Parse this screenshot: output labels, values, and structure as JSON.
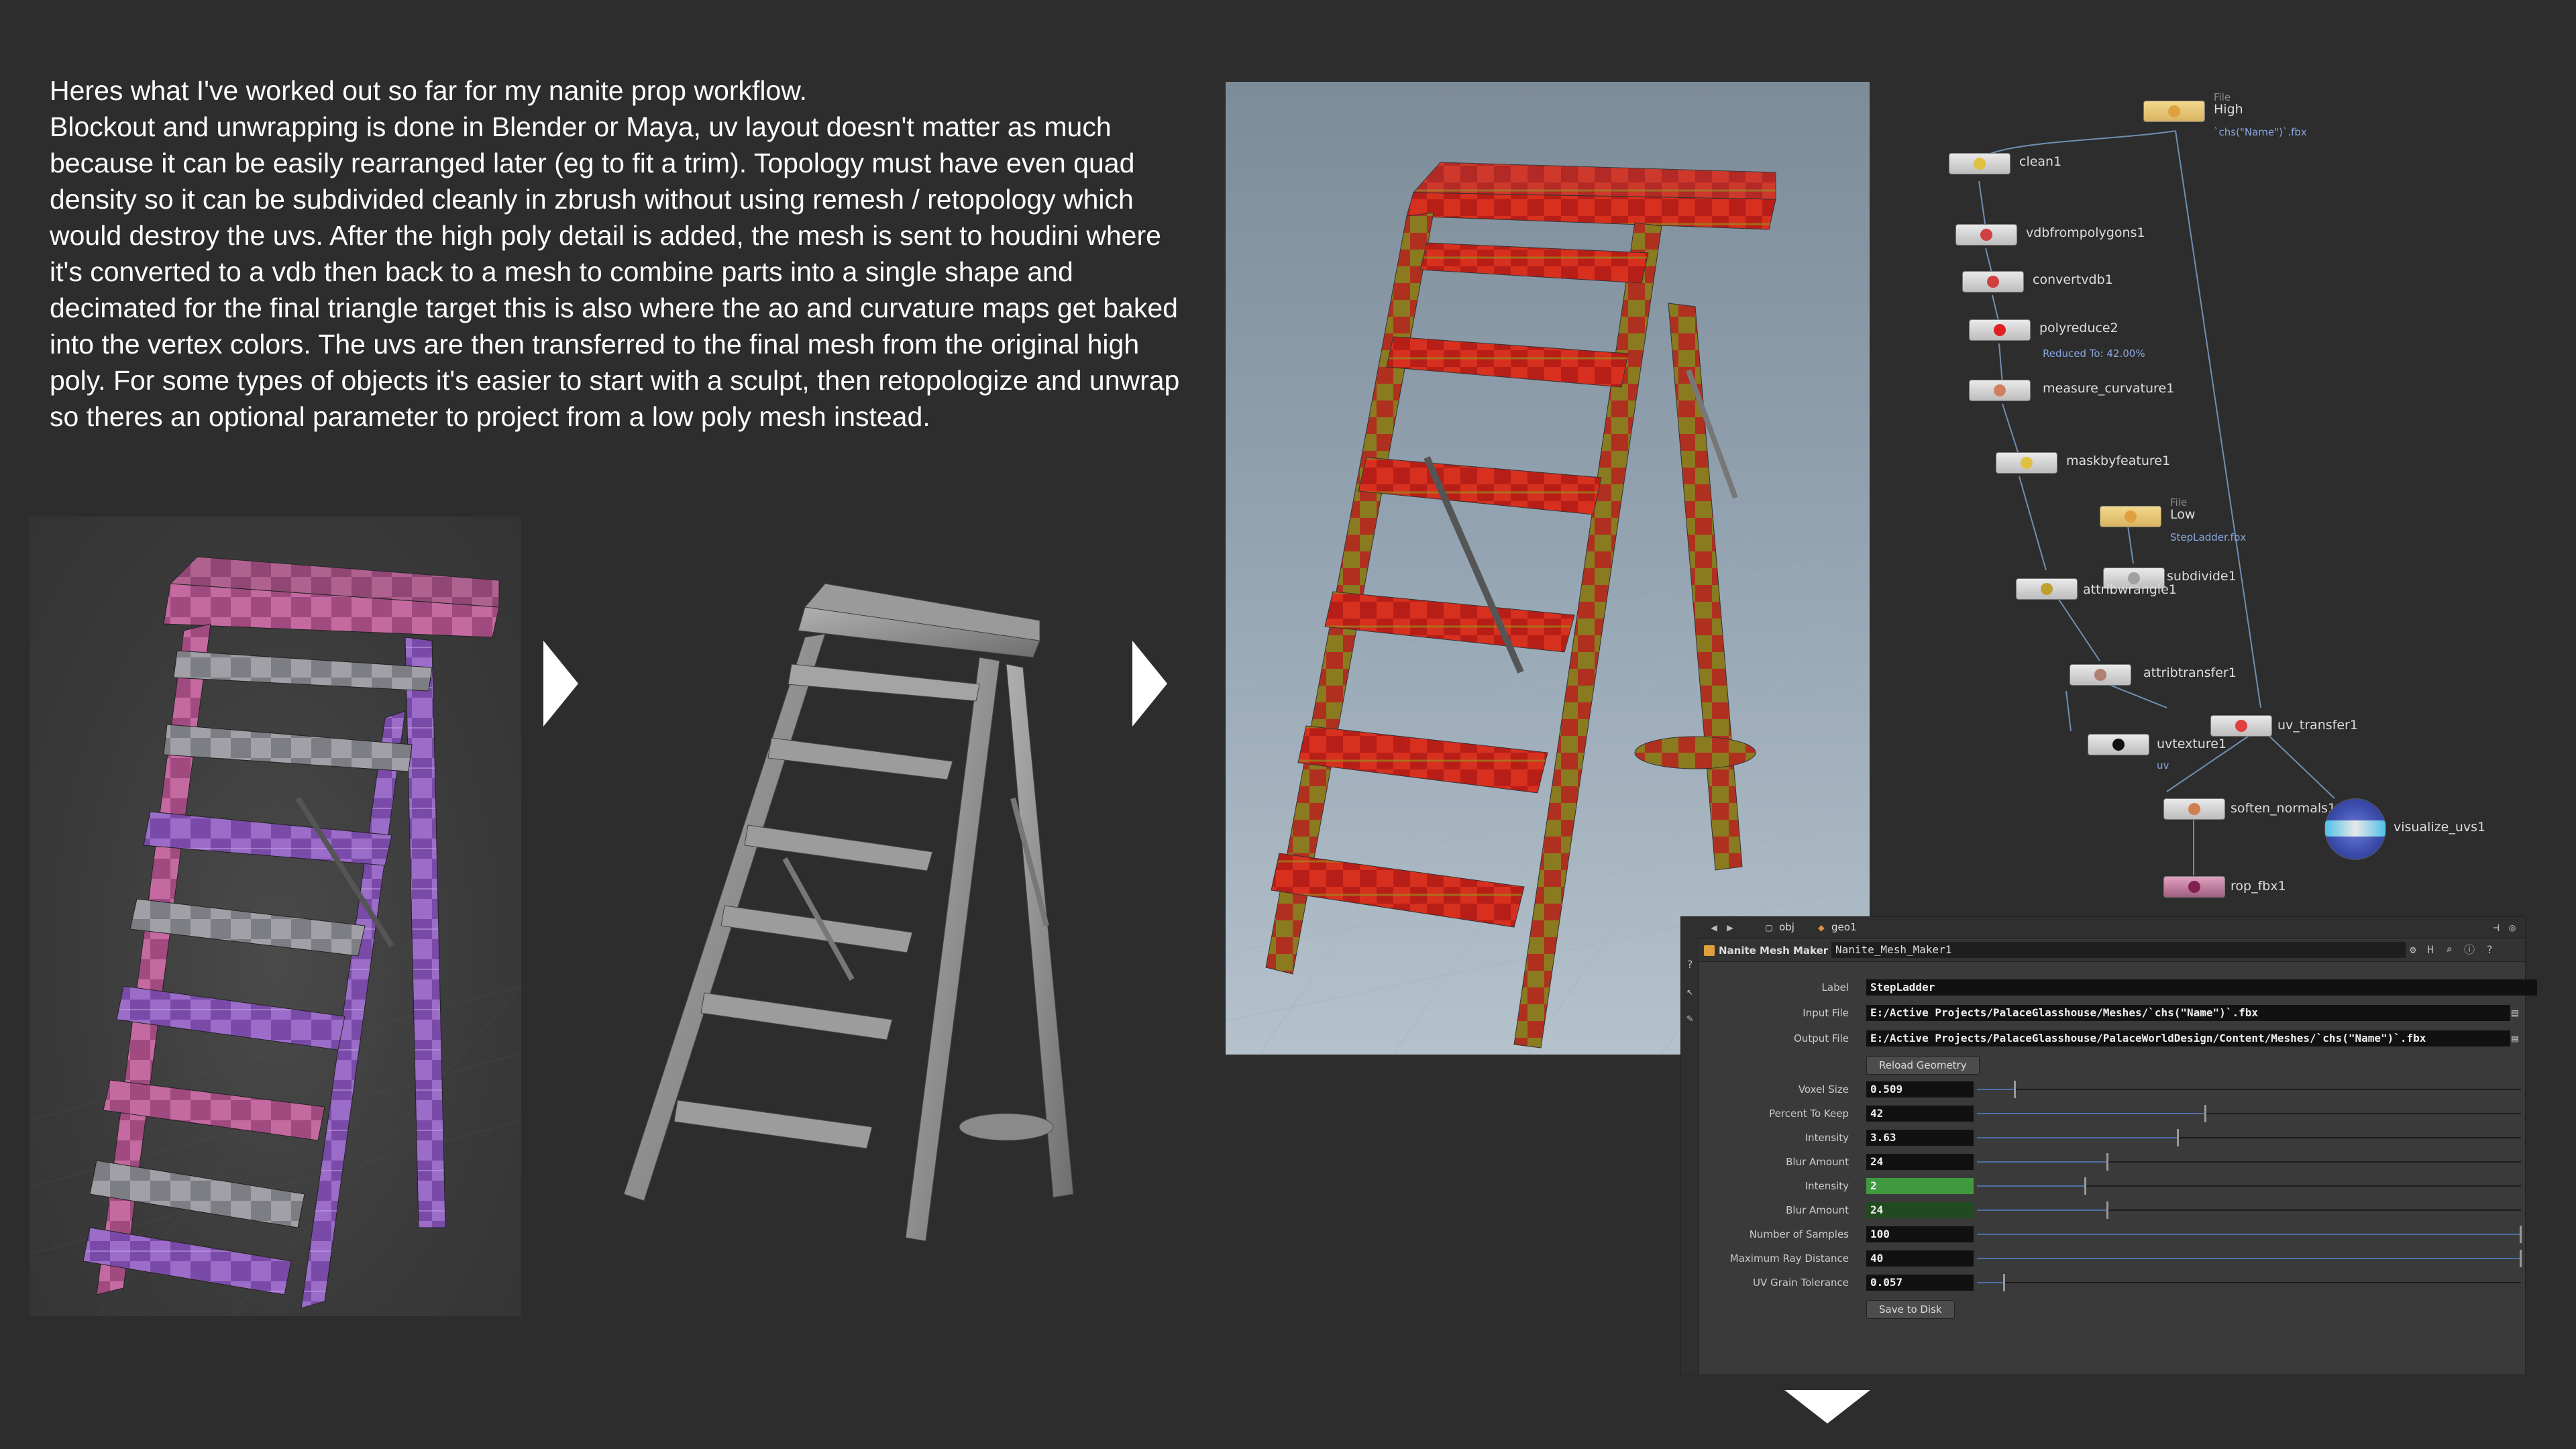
{
  "intro": {
    "heading": "Heres what I've worked out so far for my nanite prop workflow.",
    "body": "Blockout and unwrapping is done in Blender or Maya, uv layout doesn't matter as much because it can be easily rearranged later (eg to fit a trim). Topology must have even quad density so it can be subdivided cleanly in zbrush without using remesh / retopology which would destroy the uvs. After the high poly detail is added, the mesh is sent to houdini where it's converted to a vdb then back to a mesh to combine parts into a single shape and decimated for the final triangle target this is also where the ao and curvature maps get baked into the vertex colors. The uvs are then transferred to the final mesh from the original high poly. For some types of objects it's easier to start with a sculpt, then retopologize and unwrap so theres an optional parameter to project from a low poly mesh instead."
  },
  "colors": {
    "background": "#2d2d2d",
    "checker_purple": "#8a5bb8",
    "checker_red": "#c0241a",
    "checker_yellow": "#9a8a1a",
    "sculpt_gray": "#8e8e8e",
    "slider_blue": "#4d6fa8",
    "highlight_green": "#3f9a3f",
    "node_tan": "#e8c87a"
  },
  "node_graph": {
    "nodes": [
      {
        "id": "high",
        "label": "High",
        "file_tag": "File",
        "sub": "`chs(\"Name\")`.fbx"
      },
      {
        "id": "clean1",
        "label": "clean1"
      },
      {
        "id": "vdbfrompolygons1",
        "label": "vdbfrompolygons1"
      },
      {
        "id": "convertvdb1",
        "label": "convertvdb1"
      },
      {
        "id": "polyreduce2",
        "label": "polyreduce2",
        "sub": "Reduced To: 42.00%"
      },
      {
        "id": "measure_curvature1",
        "label": "measure_curvature1"
      },
      {
        "id": "maskbyfeature1",
        "label": "maskbyfeature1"
      },
      {
        "id": "low",
        "label": "Low",
        "file_tag": "File",
        "sub": "StepLadder.fbx"
      },
      {
        "id": "subdivide1",
        "label": "subdivide1"
      },
      {
        "id": "attribwrangle1",
        "label": "attribwrangle1"
      },
      {
        "id": "attribtransfer1",
        "label": "attribtransfer1"
      },
      {
        "id": "uv_transfer1",
        "label": "uv_transfer1"
      },
      {
        "id": "uvtexture1",
        "label": "uvtexture1",
        "sub": "uv"
      },
      {
        "id": "soften_normals1",
        "label": "soften_normals1"
      },
      {
        "id": "visualize_uvs1",
        "label": "visualize_uvs1"
      },
      {
        "id": "rop_fbx1",
        "label": "rop_fbx1"
      }
    ]
  },
  "param_panel": {
    "path": {
      "obj": "obj",
      "geo": "geo1"
    },
    "node_type": "Nanite Mesh Maker",
    "node_name": "Nanite_Mesh_Maker1",
    "params": [
      {
        "id": "label",
        "label": "Label",
        "value": "StepLadder"
      },
      {
        "id": "input_file",
        "label": "Input File",
        "value": "E:/Active Projects/PalaceGlasshouse/Meshes/`chs(\"Name\")`.fbx"
      },
      {
        "id": "output_file",
        "label": "Output File",
        "value": "E:/Active Projects/PalaceGlasshouse/PalaceWorldDesign/Content/Meshes/`chs(\"Name\")`.fbx"
      },
      {
        "id": "voxel_size",
        "label": "Voxel Size",
        "value": "0.509",
        "slider": 0.07
      },
      {
        "id": "percent_to_keep",
        "label": "Percent To Keep",
        "value": "42",
        "slider": 0.42
      },
      {
        "id": "intensity",
        "label": "Intensity",
        "value": "3.63",
        "slider": 0.37
      },
      {
        "id": "blur_amount",
        "label": "Blur Amount",
        "value": "24",
        "slider": 0.24
      },
      {
        "id": "intensity_2",
        "label": "Intensity",
        "value": "2",
        "slider": 0.2
      },
      {
        "id": "blur_amount_2",
        "label": "Blur Amount",
        "value": "24",
        "slider": 0.24
      },
      {
        "id": "number_of_samples",
        "label": "Number of Samples",
        "value": "100",
        "slider": 1.0
      },
      {
        "id": "max_ray_distance",
        "label": "Maximum Ray Distance",
        "value": "40",
        "slider": 1.0
      },
      {
        "id": "uv_grain_tolerance",
        "label": "UV Grain Tolerance",
        "value": "0.057",
        "slider": 0.05
      }
    ],
    "reload_label": "Reload Geometry",
    "save_label": "Save to Disk"
  }
}
